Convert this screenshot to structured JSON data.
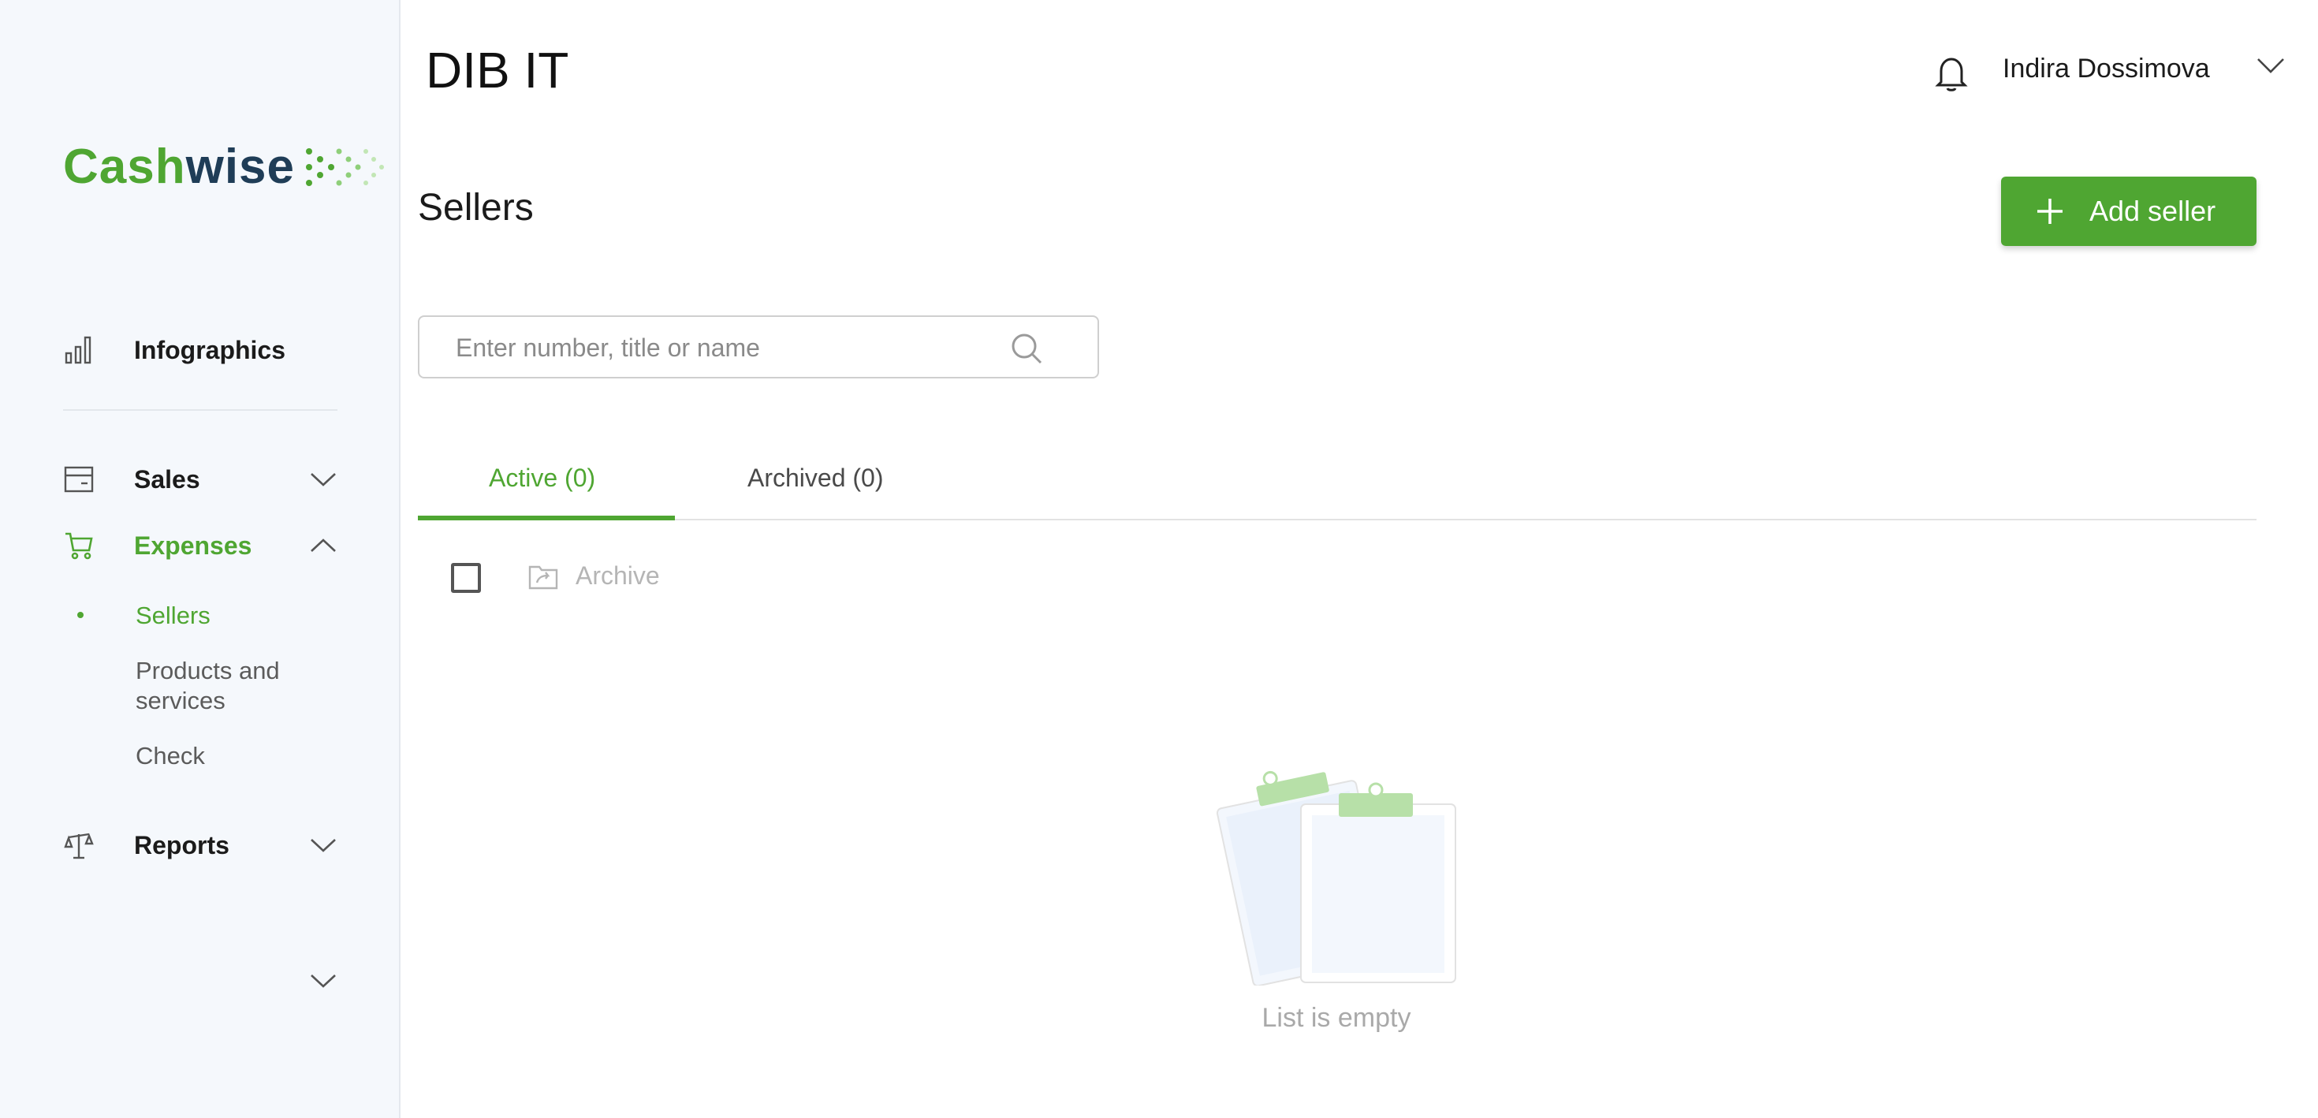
{
  "sidebar": {
    "logo": {
      "part1": "Cash",
      "part2": "wise"
    },
    "items": [
      {
        "label": "Infographics",
        "icon": "bar-chart-icon"
      },
      {
        "label": "Sales",
        "icon": "wallet-icon"
      },
      {
        "label": "Expenses",
        "icon": "cart-icon",
        "expanded": true
      },
      {
        "label": "Reports",
        "icon": "scales-icon"
      }
    ],
    "expenses_subitems": [
      {
        "label": "Sellers",
        "active": true
      },
      {
        "label": "Products and services"
      },
      {
        "label": "Check"
      }
    ]
  },
  "header": {
    "company": "DIB IT",
    "user_name": "Indira Dossimova"
  },
  "page": {
    "title": "Sellers",
    "add_button": "Add seller",
    "search_placeholder": "Enter number, title or name",
    "tabs": [
      {
        "label": "Active (0)",
        "active": true
      },
      {
        "label": "Archived (0)",
        "active": false
      }
    ],
    "archive_action": "Archive",
    "empty_text": "List is empty"
  },
  "colors": {
    "accent": "#4fa632",
    "logo_dark": "#1f3d57",
    "sidebar_bg": "#f5f8fc"
  }
}
